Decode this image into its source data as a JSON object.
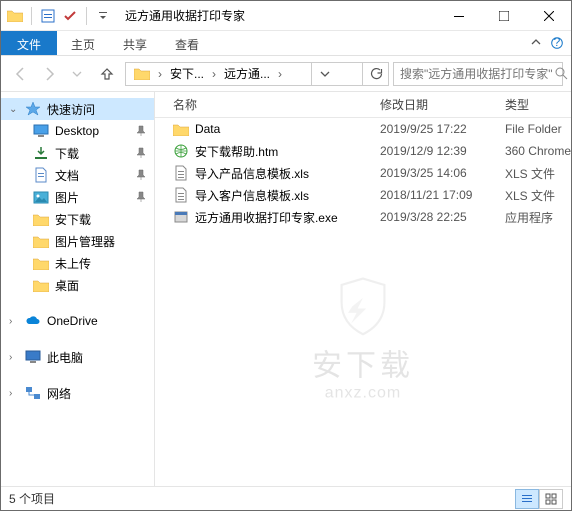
{
  "title": "远方通用收据打印专家",
  "ribbon": {
    "file": "文件",
    "home": "主页",
    "share": "共享",
    "view": "查看"
  },
  "breadcrumb": {
    "seg1": "安下...",
    "seg2": "远方通...",
    "search_placeholder": "搜索\"远方通用收据打印专家\""
  },
  "columns": {
    "name": "名称",
    "date": "修改日期",
    "type": "类型"
  },
  "sidebar": {
    "quick_access": "快速访问",
    "items": [
      {
        "label": "Desktop",
        "icon": "desktop",
        "pin": true
      },
      {
        "label": "下载",
        "icon": "downloads",
        "pin": true
      },
      {
        "label": "文档",
        "icon": "documents",
        "pin": true
      },
      {
        "label": "图片",
        "icon": "pictures",
        "pin": true
      },
      {
        "label": "安下载",
        "icon": "folder",
        "pin": false
      },
      {
        "label": "图片管理器",
        "icon": "folder",
        "pin": false
      },
      {
        "label": "未上传",
        "icon": "folder",
        "pin": false
      },
      {
        "label": "桌面",
        "icon": "folder",
        "pin": false
      }
    ],
    "onedrive": "OneDrive",
    "thispc": "此电脑",
    "network": "网络"
  },
  "files": [
    {
      "name": "Data",
      "date": "2019/9/25 17:22",
      "type": "File Folder",
      "icon": "folder"
    },
    {
      "name": "安下载帮助.htm",
      "date": "2019/12/9 12:39",
      "type": "360 Chrome",
      "icon": "htm"
    },
    {
      "name": "导入产品信息模板.xls",
      "date": "2019/3/25 14:06",
      "type": "XLS 文件",
      "icon": "xls"
    },
    {
      "name": "导入客户信息模板.xls",
      "date": "2018/11/21 17:09",
      "type": "XLS 文件",
      "icon": "xls"
    },
    {
      "name": "远方通用收据打印专家.exe",
      "date": "2019/3/28 22:25",
      "type": "应用程序",
      "icon": "exe"
    }
  ],
  "status": {
    "count": "5 个项目"
  },
  "watermark": {
    "text": "安下载",
    "url": "anxz.com"
  }
}
